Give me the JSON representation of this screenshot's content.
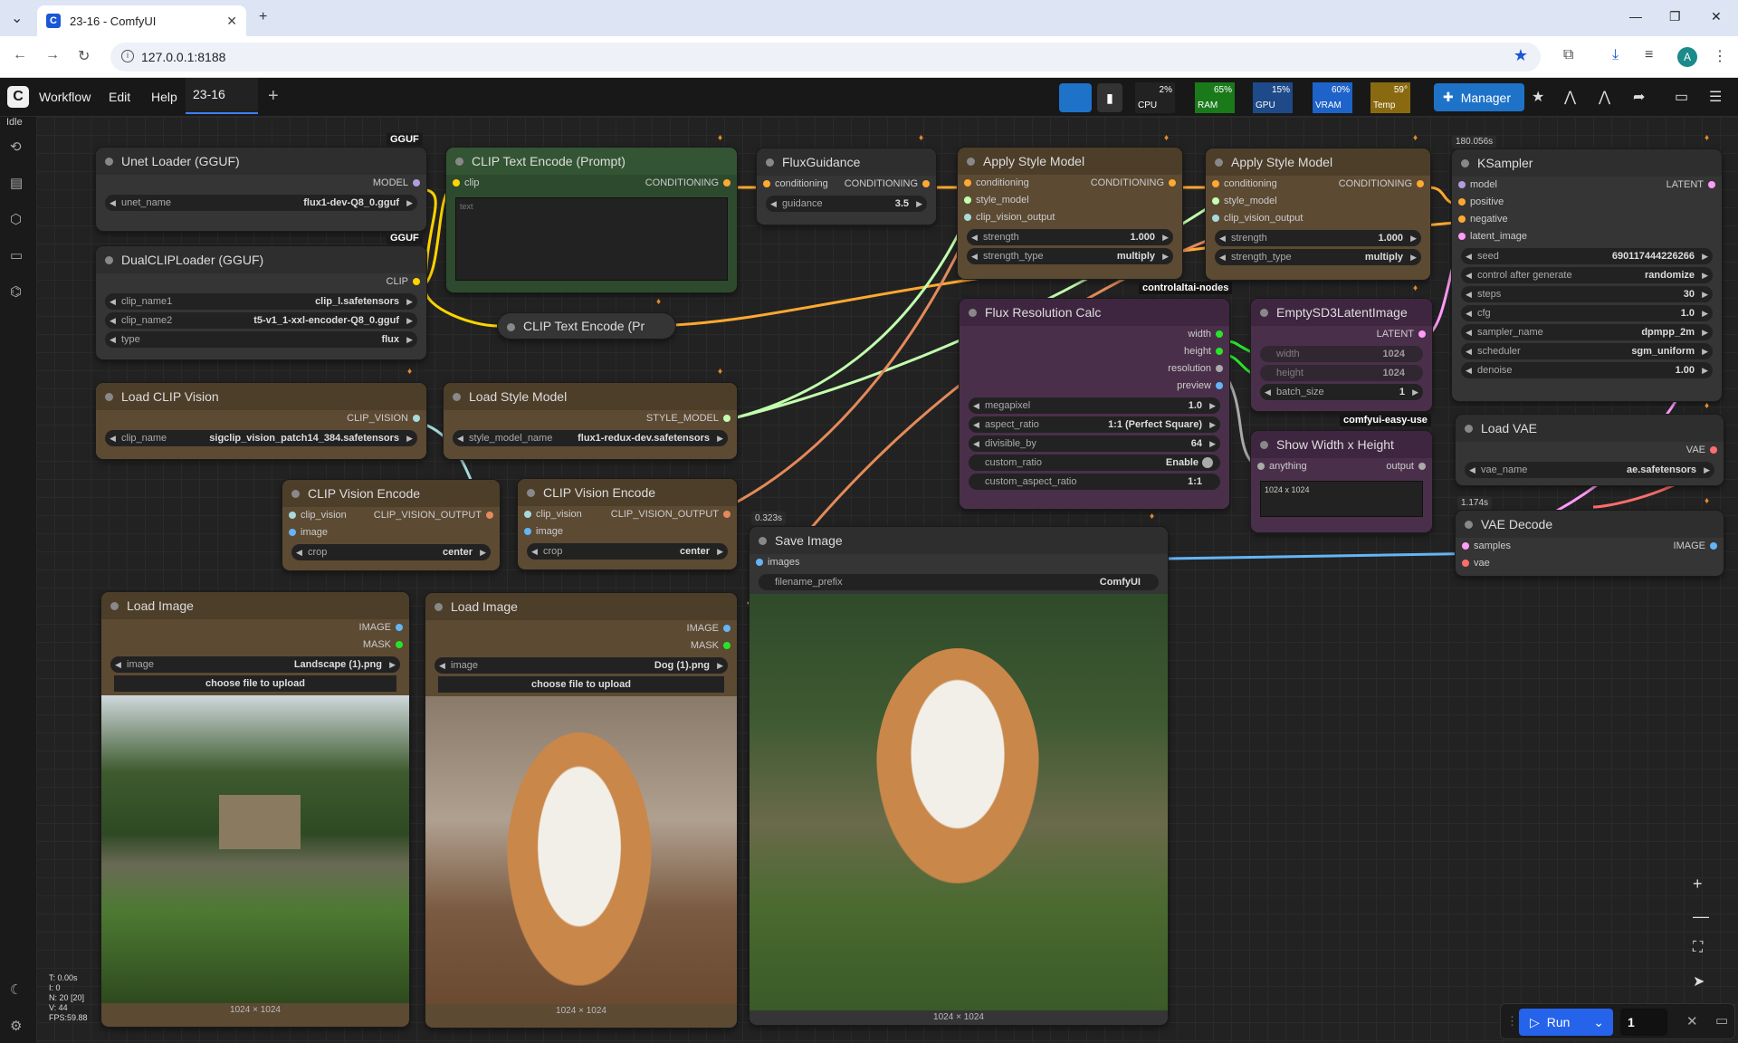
{
  "browser": {
    "tab_title": "23-16 - ComfyUI",
    "url": "127.0.0.1:8188",
    "avatar_letter": "A"
  },
  "menu": {
    "workflow": "Workflow",
    "edit": "Edit",
    "help": "Help",
    "workflow_tab": "23-16",
    "status": "Idle"
  },
  "monitors": {
    "cpu_label": "CPU",
    "cpu_value": "2%",
    "ram_label": "RAM",
    "ram_value": "65%",
    "gpu_label": "GPU",
    "gpu_value": "15%",
    "vram_label": "VRAM",
    "vram_value": "60%",
    "temp_label": "Temp",
    "temp_value": "59°",
    "manager_label": "Manager"
  },
  "nodes": {
    "unet": {
      "title": "Unet Loader (GGUF)",
      "out": "MODEL",
      "w_label": "unet_name",
      "w_value": "flux1-dev-Q8_0.gguf",
      "tag": "GGUF"
    },
    "dualclip": {
      "title": "DualCLIPLoader (GGUF)",
      "out": "CLIP",
      "tag": "GGUF",
      "w1_label": "clip_name1",
      "w1_value": "clip_l.safetensors",
      "w2_label": "clip_name2",
      "w2_value": "t5-v1_1-xxl-encoder-Q8_0.gguf",
      "w3_label": "type",
      "w3_value": "flux"
    },
    "cliptext": {
      "title": "CLIP Text Encode (Prompt)",
      "in": "clip",
      "out": "CONDITIONING",
      "placeholder": "text"
    },
    "cliptext2": {
      "title": "CLIP Text Encode (Pr"
    },
    "fluxguid": {
      "title": "FluxGuidance",
      "in": "conditioning",
      "out": "CONDITIONING",
      "w_label": "guidance",
      "w_value": "3.5"
    },
    "style1": {
      "title": "Apply Style Model",
      "in1": "conditioning",
      "in2": "style_model",
      "in3": "clip_vision_output",
      "out": "CONDITIONING",
      "w1_label": "strength",
      "w1_value": "1.000",
      "w2_label": "strength_type",
      "w2_value": "multiply",
      "tag": "controlaltai-nodes"
    },
    "style2": {
      "title": "Apply Style Model",
      "in1": "conditioning",
      "in2": "style_model",
      "in3": "clip_vision_output",
      "out": "CONDITIONING",
      "w1_label": "strength",
      "w1_value": "1.000",
      "w2_label": "strength_type",
      "w2_value": "multiply"
    },
    "ksampler": {
      "title": "KSampler",
      "time": "180.056s",
      "in1": "model",
      "in2": "positive",
      "in3": "negative",
      "in4": "latent_image",
      "out": "LATENT",
      "seed_label": "seed",
      "seed_value": "690117444226266",
      "cag_label": "control after generate",
      "cag_value": "randomize",
      "steps_label": "steps",
      "steps_value": "30",
      "cfg_label": "cfg",
      "cfg_value": "1.0",
      "sampler_label": "sampler_name",
      "sampler_value": "dpmpp_2m",
      "sched_label": "scheduler",
      "sched_value": "sgm_uniform",
      "denoise_label": "denoise",
      "denoise_value": "1.00"
    },
    "loadclipv": {
      "title": "Load CLIP Vision",
      "out": "CLIP_VISION",
      "w_label": "clip_name",
      "w_value": "sigclip_vision_patch14_384.safetensors"
    },
    "loadstyle": {
      "title": "Load Style Model",
      "out": "STYLE_MODEL",
      "w_label": "style_model_name",
      "w_value": "flux1-redux-dev.safetensors"
    },
    "fluxres": {
      "title": "Flux Resolution Calc",
      "o1": "width",
      "o2": "height",
      "o3": "resolution",
      "o4": "preview",
      "w1_label": "megapixel",
      "w1_value": "1.0",
      "w2_label": "aspect_ratio",
      "w2_value": "1:1 (Perfect Square)",
      "w3_label": "divisible_by",
      "w3_value": "64",
      "w4_label": "custom_ratio",
      "w4_value": "Enable",
      "w5_label": "custom_aspect_ratio",
      "w5_value": "1:1"
    },
    "emptylat": {
      "title": "EmptySD3LatentImage",
      "out": "LATENT",
      "w1_label": "width",
      "w1_value": "1024",
      "w2_label": "height",
      "w2_value": "1024",
      "w3_label": "batch_size",
      "w3_value": "1",
      "tag": "comfyui-easy-use"
    },
    "showwh": {
      "title": "Show Width x Height",
      "in": "anything",
      "out": "output",
      "text": "1024 x 1024"
    },
    "loadvae": {
      "title": "Load VAE",
      "out": "VAE",
      "w_label": "vae_name",
      "w_value": "ae.safetensors"
    },
    "vaedecode": {
      "title": "VAE Decode",
      "time": "1.174s",
      "in1": "samples",
      "in2": "vae",
      "out": "IMAGE"
    },
    "clipve1": {
      "title": "CLIP Vision Encode",
      "in1": "clip_vision",
      "in2": "image",
      "out": "CLIP_VISION_OUTPUT",
      "w_label": "crop",
      "w_value": "center"
    },
    "clipve2": {
      "title": "CLIP Vision Encode",
      "in1": "clip_vision",
      "in2": "image",
      "out": "CLIP_VISION_OUTPUT",
      "w_label": "crop",
      "w_value": "center"
    },
    "saveimg": {
      "title": "Save Image",
      "time": "0.323s",
      "in": "images",
      "w_label": "filename_prefix",
      "w_value": "ComfyUI",
      "caption": "1024 × 1024"
    },
    "loadimg1": {
      "title": "Load Image",
      "o1": "IMAGE",
      "o2": "MASK",
      "w_label": "image",
      "w_value": "Landscape (1).png",
      "btn": "choose file to upload",
      "caption": "1024 × 1024"
    },
    "loadimg2": {
      "title": "Load Image",
      "o1": "IMAGE",
      "o2": "MASK",
      "w_label": "image",
      "w_value": "Dog (1).png",
      "btn": "choose file to upload",
      "caption": "1024 × 1024"
    }
  },
  "stats": {
    "t": "T: 0.00s",
    "i": "I: 0",
    "n": "N: 20 [20]",
    "v": "V: 44",
    "fps": "FPS:59.88"
  },
  "run": {
    "label": "Run",
    "qty": "1"
  },
  "colors": {
    "clip": "#ffd500",
    "conditioning": "#ffa931",
    "model": "#b39ddb",
    "latent": "#ff9cf9",
    "vae": "#ff6e6e",
    "image": "#64b5f6",
    "clip_vision": "#a8dadc",
    "style_model": "#c2ffae",
    "int": "#29e329"
  }
}
